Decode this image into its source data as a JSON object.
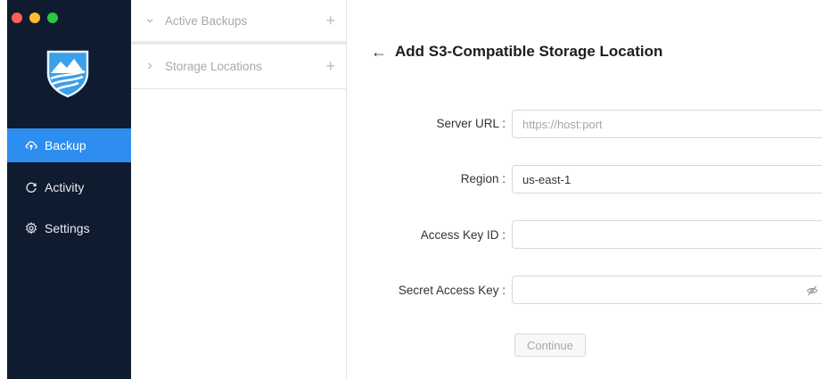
{
  "window": {
    "traffic_lights": [
      "#fe5f57",
      "#febc2e",
      "#28c840"
    ]
  },
  "sidebar": {
    "bg_color": "#0f1b2e",
    "accent_color": "#2d8ef0",
    "items": [
      {
        "label": "Backup",
        "icon": "cloud-upload-icon",
        "active": true
      },
      {
        "label": "Activity",
        "icon": "refresh-icon",
        "active": false
      },
      {
        "label": "Settings",
        "icon": "gear-icon",
        "active": false
      }
    ]
  },
  "tree": {
    "sections": [
      {
        "label": "Active Backups",
        "expanded": true,
        "chevron": "chevron-down-icon",
        "action": "+"
      },
      {
        "label": "Storage Locations",
        "expanded": false,
        "chevron": "chevron-right-icon",
        "action": "+"
      }
    ]
  },
  "form": {
    "back_icon": "←",
    "title": "Add S3-Compatible Storage Location",
    "fields": [
      {
        "label": "Server URL",
        "value": "",
        "placeholder": "https://host:port"
      },
      {
        "label": "Region",
        "value": "us-east-1",
        "placeholder": ""
      },
      {
        "label": "Access Key ID",
        "value": "",
        "placeholder": ""
      },
      {
        "label": "Secret Access Key",
        "value": "",
        "placeholder": "",
        "icon": "eye-off-icon"
      }
    ],
    "continue_label": "Continue"
  }
}
